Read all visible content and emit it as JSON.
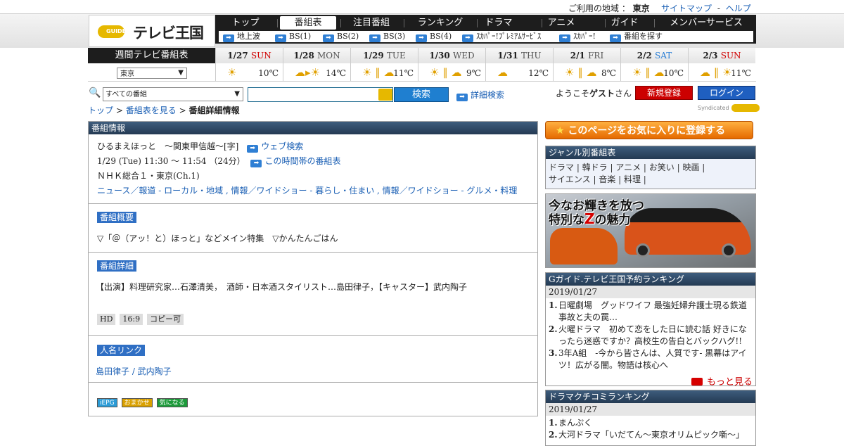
{
  "topbar": {
    "area_label": "ご利用の地域 ：",
    "area_value": "東京",
    "sitemap": "サイトマップ",
    "sep": "-",
    "help": "ヘルプ"
  },
  "logo": {
    "mark": "GUIDE",
    "text": "テレビ王国"
  },
  "nav": {
    "tabs": [
      "トップ",
      "番組表",
      "注目番組",
      "ランキング",
      "ドラマ",
      "アニメ",
      "ガイド",
      "メンバーサービス"
    ],
    "sub": [
      "地上波",
      "BS(1)",
      "BS(2)",
      "BS(3)",
      "BS(4)",
      "ｽｶﾊﾟｰ!ﾌﾟﾚﾐｱﾑｻｰﾋﾞｽ",
      "ｽｶﾊﾟｰ!",
      "番組を探す"
    ]
  },
  "weather": {
    "label": "週間テレビ番組表",
    "region": "東京",
    "days": [
      {
        "date": "1/27",
        "dow": "SUN",
        "kind": "sun",
        "icon": "☀",
        "temp": "10℃"
      },
      {
        "date": "1/28",
        "dow": "MON",
        "kind": "",
        "icon": "☁▸☀",
        "temp": "14℃"
      },
      {
        "date": "1/29",
        "dow": "TUE",
        "kind": "",
        "icon": "☀ ∥ ☁",
        "temp": "11℃"
      },
      {
        "date": "1/30",
        "dow": "WED",
        "kind": "",
        "icon": "☀ ∥ ☁",
        "temp": "9℃"
      },
      {
        "date": "1/31",
        "dow": "THU",
        "kind": "",
        "icon": "☁",
        "temp": "12℃"
      },
      {
        "date": "2/1",
        "dow": "FRI",
        "kind": "",
        "icon": "☀ ∥ ☁",
        "temp": "8℃"
      },
      {
        "date": "2/2",
        "dow": "SAT",
        "kind": "sat",
        "icon": "☀ ∥ ☁",
        "temp": "10℃"
      },
      {
        "date": "2/3",
        "dow": "SUN",
        "kind": "sun",
        "icon": "☁ ∥ ☀",
        "temp": "11℃"
      }
    ]
  },
  "search": {
    "select": "すべての番組",
    "button": "検索",
    "advanced": "詳細検索"
  },
  "user": {
    "welcome_pre": "ようこそ",
    "guest": "ゲスト",
    "welcome_post": "さん",
    "register": "新規登録",
    "login": "ログイン",
    "syndicated": "Syndicated"
  },
  "breadcrumb": {
    "top": "トップ",
    "sep": ">",
    "schedule": "番組表を見る",
    "current": "番組詳細情報"
  },
  "program": {
    "header": "番組情報",
    "title": "ひるまえほっと　～関東甲信越～[字]",
    "web_search": "ウェブ検索",
    "time": "1/29 (Tue) 11:30 ～ 11:54 （24分）",
    "time_link": "この時間帯の番組表",
    "channel": "ＮＨＫ総合１・東京(Ch.1)",
    "genres": "ニュース／報道 - ローカル・地域 , 情報／ワイドショー - 暮らし・住まい , 情報／ワイドショー - グルメ・料理",
    "summary_label": "番組概要",
    "summary": "▽「＠（アッ！と）ほっと」などメイン特集　▽かんたんごはん",
    "detail_label": "番組詳細",
    "detail": "【出演】料理研究家…石澤清美，　酒師・日本酒スタイリスト…島田律子，【キャスター】武内陶子",
    "flags": [
      "HD",
      "16:9",
      "コピー可"
    ],
    "people_label": "人名リンク",
    "people": "島田律子 / 武内陶子",
    "badges": [
      "iEPG",
      "おまかせ",
      "気になる"
    ]
  },
  "sidebar": {
    "favorite": "このページをお気に入りに登録する",
    "genre_header": "ジャンル別番組表",
    "genre_line1": "ドラマ | 韓ドラ | アニメ | お笑い | 映画 |",
    "genre_line2": "サイエンス | 音楽 | 料理 |",
    "ad_line1": "今なお輝きを放つ",
    "ad_line2_pre": "特別な",
    "ad_line2_z": "Z",
    "ad_line2_post": "の魅力",
    "ranking_header": "Gガイド.テレビ王国予約ランキング",
    "ranking_date": "2019/01/27",
    "ranking": [
      "日曜劇場　グッドワイフ 最強妊婦弁護士現る鉄道事故と夫の罠…",
      "火曜ドラマ　初めて恋をした日に読む話 好きになったら迷惑ですか？高校生の告白とバックハグ!!",
      "3年A組　‐今から皆さんは、人質です‐ 黒幕はアイツ！広がる闇。物語は核心へ"
    ],
    "more": "もっと見る",
    "drama_header": "ドラマクチコミランキング",
    "drama_date": "2019/01/27",
    "drama": [
      "まんぷく",
      "大河ドラマ「いだてん～東京オリムピック噺～」"
    ]
  },
  "colors": {
    "accent": "#1a5fb4",
    "nav": "#1d1d1d",
    "sun": "#d10000",
    "sat": "#2a7fd6",
    "header": "#2f4a66"
  }
}
